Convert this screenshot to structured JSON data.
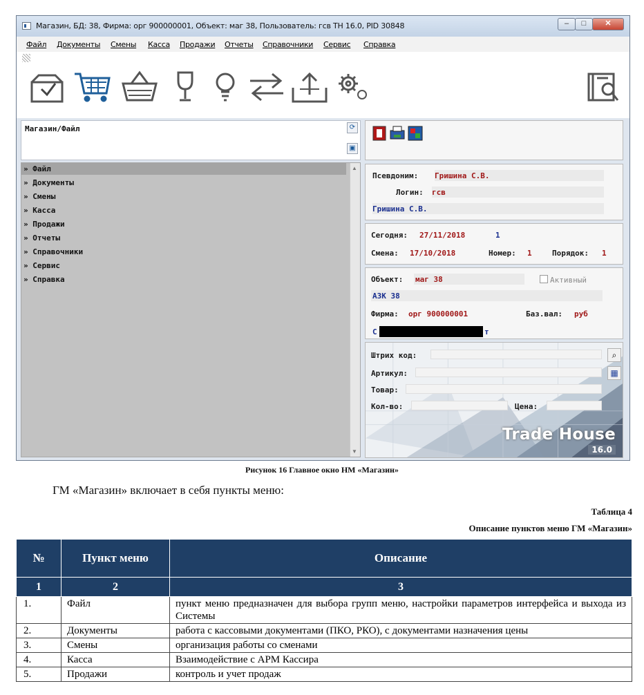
{
  "window": {
    "title": "Магазин, БД: 38, Фирма: орг 900000001, Объект: маг 38, Пользователь: гсв  TH 16.0, PID 30848",
    "controls": {
      "minimize": "–",
      "maximize": "□",
      "close": "✕"
    }
  },
  "menubar": [
    {
      "label": "Файл"
    },
    {
      "label": "Документы"
    },
    {
      "label": "Смены"
    },
    {
      "label": "Касса"
    },
    {
      "label": "Продажи"
    },
    {
      "label": "Отчеты"
    },
    {
      "label": "Справочники"
    },
    {
      "label": "Сервис"
    },
    {
      "label": "Справка"
    }
  ],
  "toolbar": {
    "icons": [
      "open-box-icon",
      "shopping-cart-icon",
      "basket-icon",
      "wine-glass-icon",
      "lightbulb-icon",
      "exchange-arrows-icon",
      "upload-box-icon",
      "gears-icon",
      "search-document-icon"
    ]
  },
  "left_panel": {
    "path": "Магазин/Файл",
    "tree": [
      "» Файл",
      "» Документы",
      "» Смены",
      "» Касса",
      "» Продажи",
      "» Отчеты",
      "» Справочники",
      "» Сервис",
      "» Справка"
    ]
  },
  "user_panel": {
    "alias_label": "Псевдоним:",
    "alias_value": "Гришина С.В.",
    "login_label": "Логин:",
    "login_value": "гсв",
    "full_name": "Гришина С.В."
  },
  "date_panel": {
    "today_label": "Сегодня:",
    "today_value": "27/11/2018",
    "shift_icon_text": "1",
    "shift_label": "Смена:",
    "shift_value": "17/10/2018",
    "number_label": "Номер:",
    "number_value": "1",
    "order_label": "Порядок:",
    "order_value": "1"
  },
  "object_panel": {
    "object_label": "Объект:",
    "object_value": "маг 38",
    "active_label": "Активный",
    "object_name": "АЗК 38",
    "firm_label": "Фирма:",
    "firm_value": "орг 900000001",
    "currency_label": "Баз.вал:",
    "currency_value": "руб",
    "redacted_prefix": "С",
    "redacted_suffix": "т"
  },
  "goods_panel": {
    "barcode_label": "Штрих код:",
    "article_label": "Артикул:",
    "product_label": "Товар:",
    "qty_label": "Кол-во:",
    "price_label": "Цена:",
    "logo": "Trade House",
    "version": "16.0"
  },
  "document": {
    "figure_caption": "Рисунок 16 Главное окно НМ «Магазин»",
    "paragraph": "ГМ «Магазин» включает в себя пункты меню:",
    "table_number": "Таблица 4",
    "table_caption": "Описание пунктов меню ГМ «Магазин»",
    "table": {
      "headers": [
        "№",
        "Пункт меню",
        "Описание"
      ],
      "index_row": [
        "1",
        "2",
        "3"
      ],
      "rows": [
        [
          "1.",
          "Файл",
          "пункт меню предназначен для выбора групп меню, настройки параметров интерфейса и выхода из Системы"
        ],
        [
          "2.",
          "Документы",
          "работа с кассовыми документами (ПКО, РКО), с документами назначения цены"
        ],
        [
          "3.",
          "Смены",
          "организация работы со сменами"
        ],
        [
          "4.",
          "Касса",
          "Взаимодействие с АРМ Кассира"
        ],
        [
          "5.",
          "Продажи",
          "контроль и учет продаж"
        ]
      ]
    }
  }
}
